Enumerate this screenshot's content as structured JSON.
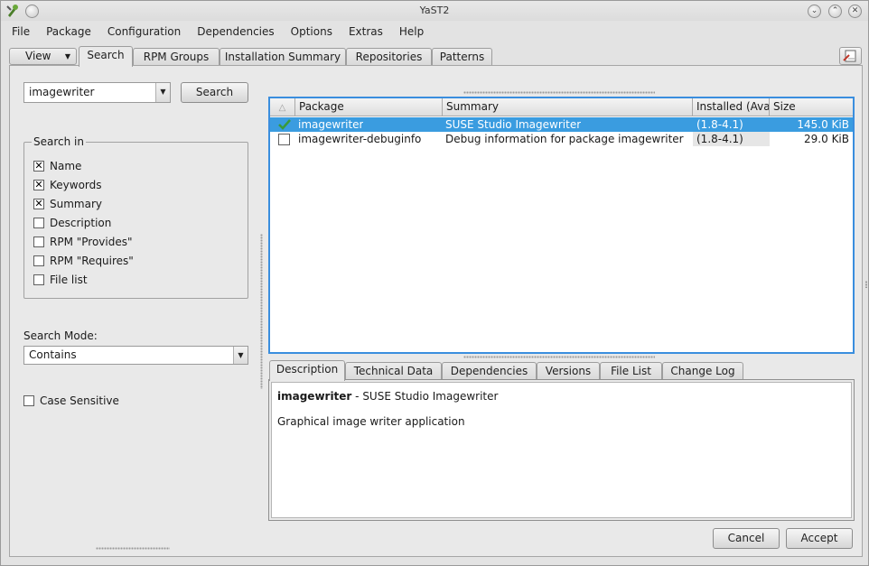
{
  "window": {
    "title": "YaST2"
  },
  "menu": [
    "File",
    "Package",
    "Configuration",
    "Dependencies",
    "Options",
    "Extras",
    "Help"
  ],
  "view_button": "View",
  "tabs": [
    "Search",
    "RPM Groups",
    "Installation Summary",
    "Repositories",
    "Patterns"
  ],
  "search": {
    "value": "imagewriter",
    "button": "Search",
    "group_title": "Search in",
    "options": [
      {
        "label": "Name",
        "checked": true
      },
      {
        "label": "Keywords",
        "checked": true
      },
      {
        "label": "Summary",
        "checked": true
      },
      {
        "label": "Description",
        "checked": false
      },
      {
        "label": "RPM \"Provides\"",
        "checked": false
      },
      {
        "label": "RPM \"Requires\"",
        "checked": false
      },
      {
        "label": "File list",
        "checked": false
      }
    ],
    "mode_label": "Search Mode:",
    "mode_value": "Contains",
    "case_label": "Case Sensitive"
  },
  "package_table": {
    "columns": [
      "Package",
      "Summary",
      "Installed (Avai",
      "Size"
    ],
    "rows": [
      {
        "name": "imagewriter",
        "summary": "SUSE Studio Imagewriter",
        "version": "(1.8-4.1)",
        "size": "145.0 KiB",
        "status": "install"
      },
      {
        "name": "imagewriter-debuginfo",
        "summary": "Debug information for package imagewriter",
        "version": "(1.8-4.1)",
        "size": "29.0 KiB",
        "status": "none"
      }
    ]
  },
  "detail_tabs": [
    "Description",
    "Technical Data",
    "Dependencies",
    "Versions",
    "File List",
    "Change Log"
  ],
  "description": {
    "name": "imagewriter",
    "summary": " - SUSE Studio Imagewriter",
    "text": "Graphical image writer application"
  },
  "buttons": {
    "cancel": "Cancel",
    "accept": "Accept"
  },
  "colors": {
    "selection": "#3a9ce0",
    "focus_border": "#3a8ede",
    "check_green": "#3a9a3a"
  }
}
